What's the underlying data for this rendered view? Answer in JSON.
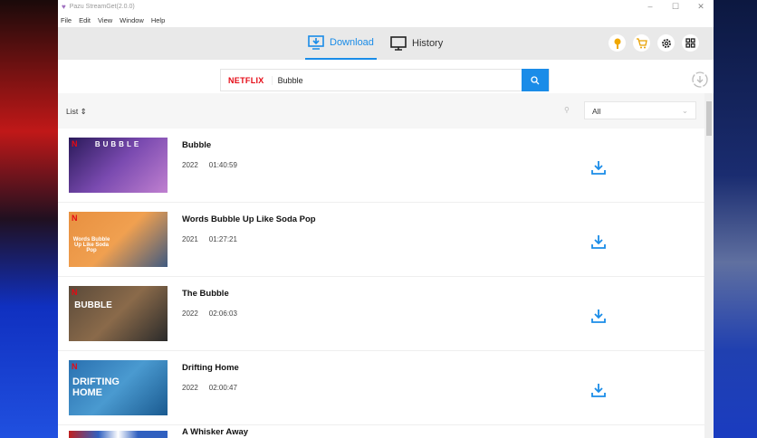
{
  "window": {
    "title": "Pazu StreamGet(2.0.0)",
    "minimize": "–",
    "maximize": "☐",
    "close": "✕"
  },
  "menu": [
    "File",
    "Edit",
    "View",
    "Window",
    "Help"
  ],
  "tabs": {
    "download": "Download",
    "history": "History"
  },
  "search": {
    "service": "NETFLIX",
    "query": "Bubble"
  },
  "list": {
    "label": "List ⇕",
    "filter": "All"
  },
  "items": [
    {
      "title": "Bubble",
      "year": "2022",
      "duration": "01:40:59",
      "thumb_text": "BUBBLE"
    },
    {
      "title": "Words Bubble Up Like Soda Pop",
      "year": "2021",
      "duration": "01:27:21",
      "thumb_text": "Words Bubble Up Like Soda Pop"
    },
    {
      "title": "The Bubble",
      "year": "2022",
      "duration": "02:06:03",
      "thumb_text": "BUBBLE"
    },
    {
      "title": "Drifting Home",
      "year": "2022",
      "duration": "02:00:47",
      "thumb_text": "DRIFTING HOME"
    },
    {
      "title": "A Whisker Away",
      "year": "",
      "duration": "",
      "thumb_text": ""
    }
  ]
}
